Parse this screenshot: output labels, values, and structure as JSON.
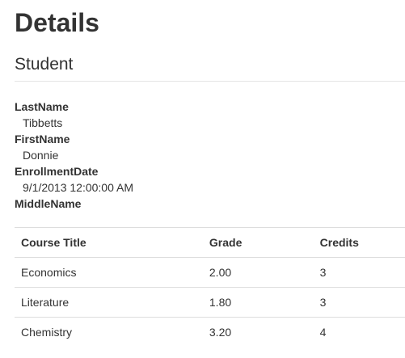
{
  "page": {
    "title": "Details",
    "section_title": "Student"
  },
  "student": {
    "fields": [
      {
        "label": "LastName",
        "value": "Tibbetts"
      },
      {
        "label": "FirstName",
        "value": "Donnie"
      },
      {
        "label": "EnrollmentDate",
        "value": "9/1/2013 12:00:00 AM"
      },
      {
        "label": "MiddleName",
        "value": ""
      }
    ]
  },
  "enrollments": {
    "headers": [
      "Course Title",
      "Grade",
      "Credits"
    ],
    "rows": [
      [
        "Economics",
        "2.00",
        "3"
      ],
      [
        "Literature",
        "1.80",
        "3"
      ],
      [
        "Chemistry",
        "3.20",
        "4"
      ]
    ]
  }
}
